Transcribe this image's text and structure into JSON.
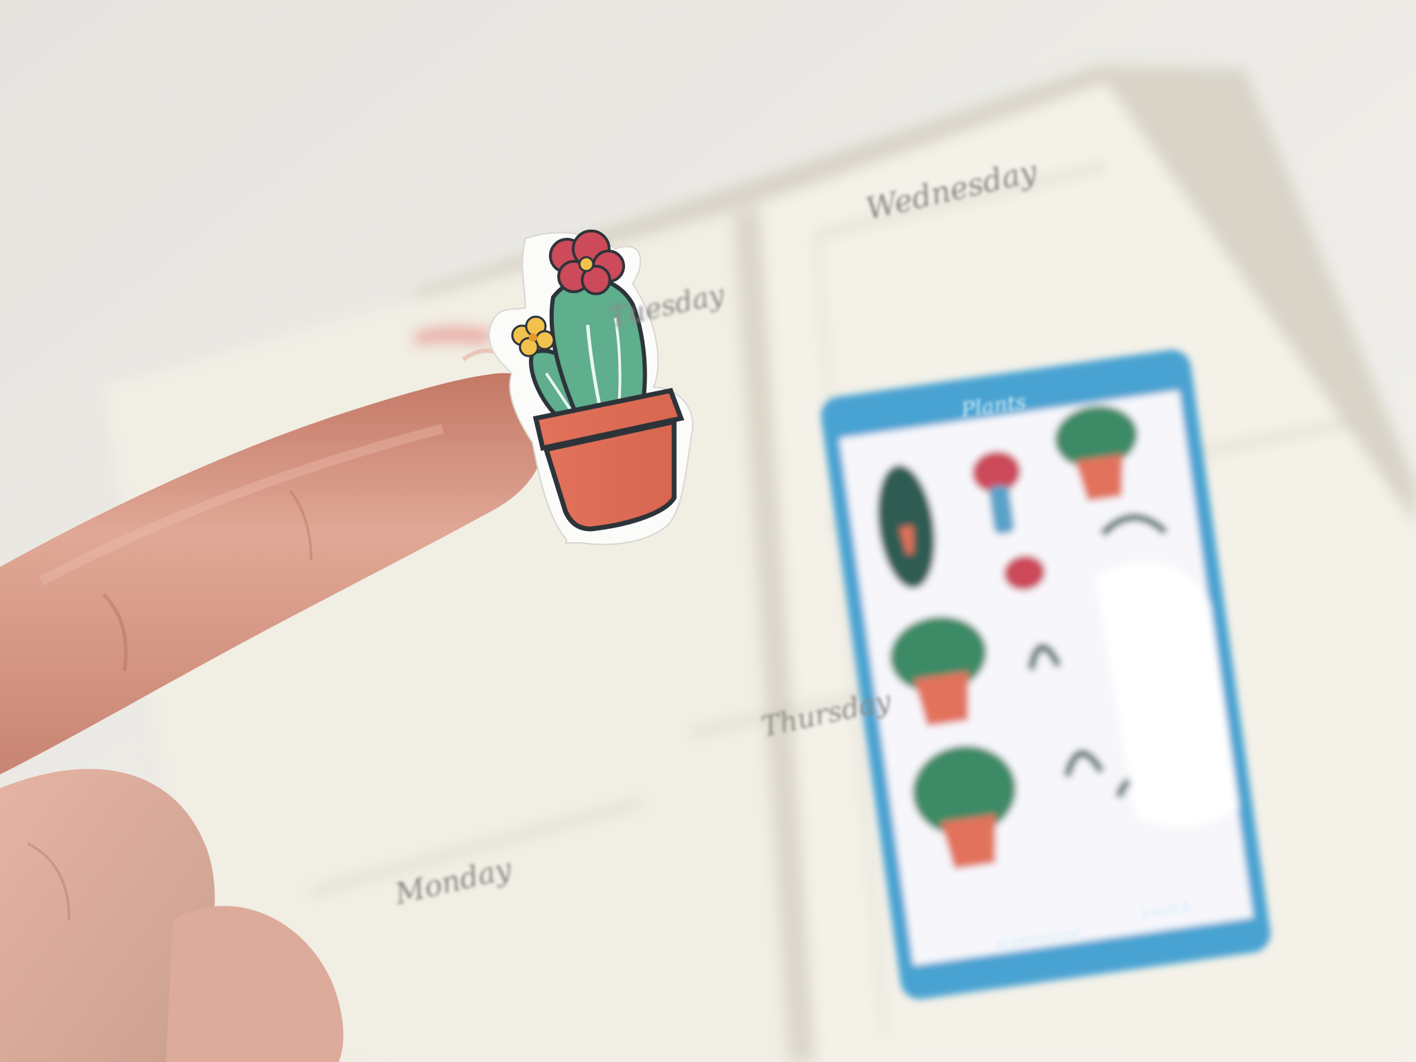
{
  "scene": {
    "type": "photo",
    "colors": {
      "background": "#e9e7e2",
      "notebook_page": "#f3f0e6",
      "sheet_frame": "#4aa3d2",
      "sticker_pot": "#e2725b",
      "sticker_cactus": "#5fae8e",
      "sticker_flower_red": "#cc4a5a",
      "sticker_flower_yellow": "#f2c14e",
      "finger": "#d99a86"
    },
    "page_labels": [
      "Wednesday",
      "Tuesday",
      "Thursday",
      "Monday"
    ],
    "sticker_sheet": {
      "title": "Plants",
      "footer_left": "@penelope",
      "footer_right": "kwitch"
    }
  }
}
